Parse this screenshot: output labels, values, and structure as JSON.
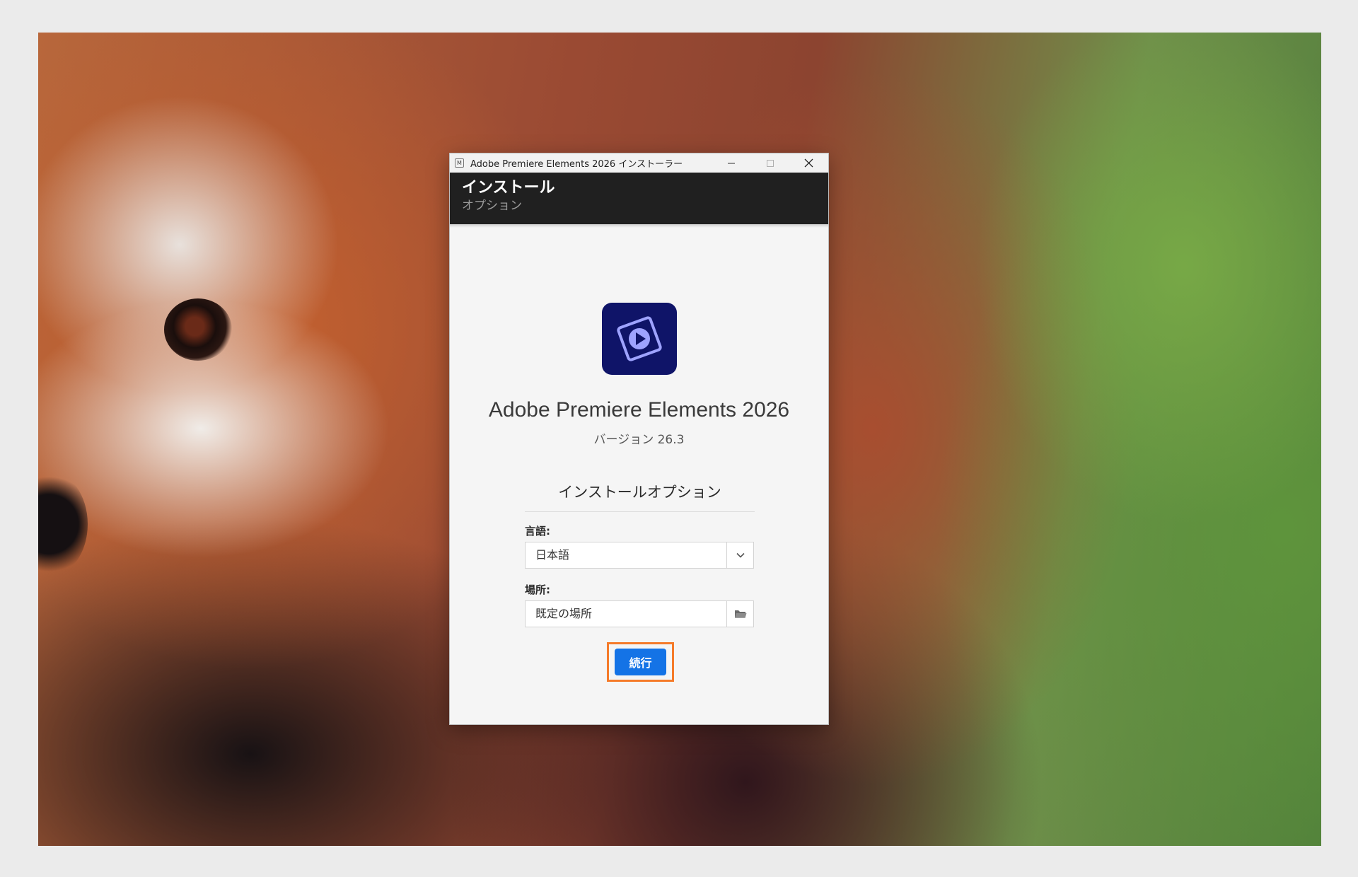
{
  "window": {
    "title": "Adobe Premiere Elements 2026 インストーラー",
    "app_mini_icon": "M",
    "controls": [
      "minimize-icon",
      "maximize-icon",
      "close-icon"
    ]
  },
  "header": {
    "title": "インストール",
    "subtitle": "オプション"
  },
  "product": {
    "icon": "premiere-elements-play-icon",
    "name": "Adobe Premiere Elements 2026",
    "version": "バージョン 26.3"
  },
  "options": {
    "section_title": "インストールオプション",
    "language_label": "言語:",
    "language_value": "日本語",
    "location_label": "場所:",
    "location_value": "既定の場所"
  },
  "actions": {
    "continue_label": "続行"
  },
  "colors": {
    "header_bg": "#202020",
    "accent_blue": "#1473e6",
    "highlight_orange": "#f57b2a",
    "product_icon_bg": "#0f1468",
    "product_icon_fg": "#9ea3ff"
  }
}
